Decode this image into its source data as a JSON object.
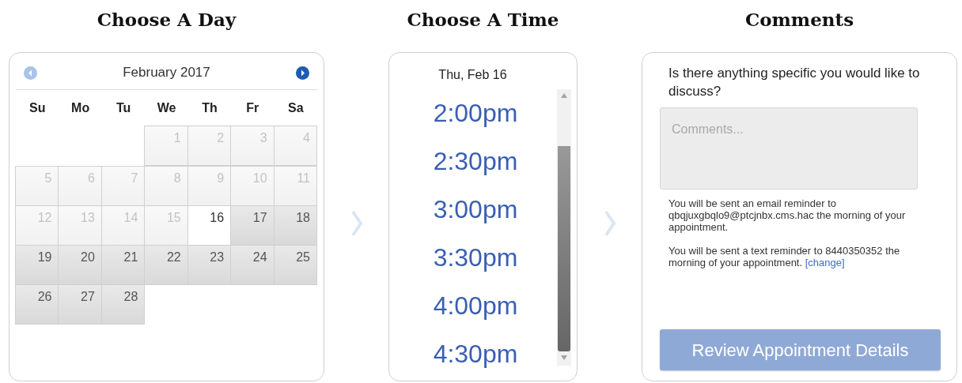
{
  "sections": [
    {
      "heading": "Choose A Day"
    },
    {
      "heading": "Choose A Time"
    },
    {
      "heading": "Comments"
    }
  ],
  "calendar": {
    "month": "February 2017",
    "prev_button": {
      "disabled": true
    },
    "next_button": {
      "disabled": false
    },
    "weekdays": [
      "Su",
      "Mo",
      "Tu",
      "We",
      "Th",
      "Fr",
      "Sa"
    ],
    "days": [
      {
        "kind": "blank"
      },
      {
        "kind": "blank"
      },
      {
        "kind": "blank"
      },
      {
        "kind": "day",
        "label": "1",
        "disabled": true,
        "selected": false
      },
      {
        "kind": "day",
        "label": "2",
        "disabled": true,
        "selected": false
      },
      {
        "kind": "day",
        "label": "3",
        "disabled": true,
        "selected": false
      },
      {
        "kind": "day",
        "label": "4",
        "disabled": true,
        "selected": false
      },
      {
        "kind": "day",
        "label": "5",
        "disabled": true,
        "selected": false
      },
      {
        "kind": "day",
        "label": "6",
        "disabled": true,
        "selected": false
      },
      {
        "kind": "day",
        "label": "7",
        "disabled": true,
        "selected": false
      },
      {
        "kind": "day",
        "label": "8",
        "disabled": true,
        "selected": false
      },
      {
        "kind": "day",
        "label": "9",
        "disabled": true,
        "selected": false
      },
      {
        "kind": "day",
        "label": "10",
        "disabled": true,
        "selected": false
      },
      {
        "kind": "day",
        "label": "11",
        "disabled": true,
        "selected": false
      },
      {
        "kind": "day",
        "label": "12",
        "disabled": true,
        "selected": false
      },
      {
        "kind": "day",
        "label": "13",
        "disabled": true,
        "selected": false
      },
      {
        "kind": "day",
        "label": "14",
        "disabled": true,
        "selected": false
      },
      {
        "kind": "day",
        "label": "15",
        "disabled": true,
        "selected": false
      },
      {
        "kind": "day",
        "label": "16",
        "disabled": false,
        "selected": true
      },
      {
        "kind": "day",
        "label": "17",
        "disabled": false,
        "selected": false
      },
      {
        "kind": "day",
        "label": "18",
        "disabled": false,
        "selected": false
      },
      {
        "kind": "day",
        "label": "19",
        "disabled": false,
        "selected": false
      },
      {
        "kind": "day",
        "label": "20",
        "disabled": false,
        "selected": false
      },
      {
        "kind": "day",
        "label": "21",
        "disabled": false,
        "selected": false
      },
      {
        "kind": "day",
        "label": "22",
        "disabled": false,
        "selected": false
      },
      {
        "kind": "day",
        "label": "23",
        "disabled": false,
        "selected": false
      },
      {
        "kind": "day",
        "label": "24",
        "disabled": false,
        "selected": false
      },
      {
        "kind": "day",
        "label": "25",
        "disabled": false,
        "selected": false
      },
      {
        "kind": "day",
        "label": "26",
        "disabled": false,
        "selected": false
      },
      {
        "kind": "day",
        "label": "27",
        "disabled": false,
        "selected": false
      },
      {
        "kind": "day",
        "label": "28",
        "disabled": false,
        "selected": false
      }
    ]
  },
  "times": {
    "date": "Thu, Feb 16",
    "slots": [
      "2:00pm",
      "2:30pm",
      "3:00pm",
      "3:30pm",
      "4:00pm",
      "4:30pm"
    ]
  },
  "comments": {
    "question": "Is there anything specific you would like to discuss?",
    "placeholder": "Comments...",
    "notes": [
      {
        "text": "You will be sent an email reminder to qbqjuxgbqlo9@ptcjnbx.cms.hac the morning of your appointment."
      },
      {
        "text": "You will be sent a text reminder to 8440350352 the morning of your appointment.",
        "link": "[change]"
      }
    ],
    "button": {
      "label": "Review Appointment Details",
      "disabled": true
    }
  }
}
